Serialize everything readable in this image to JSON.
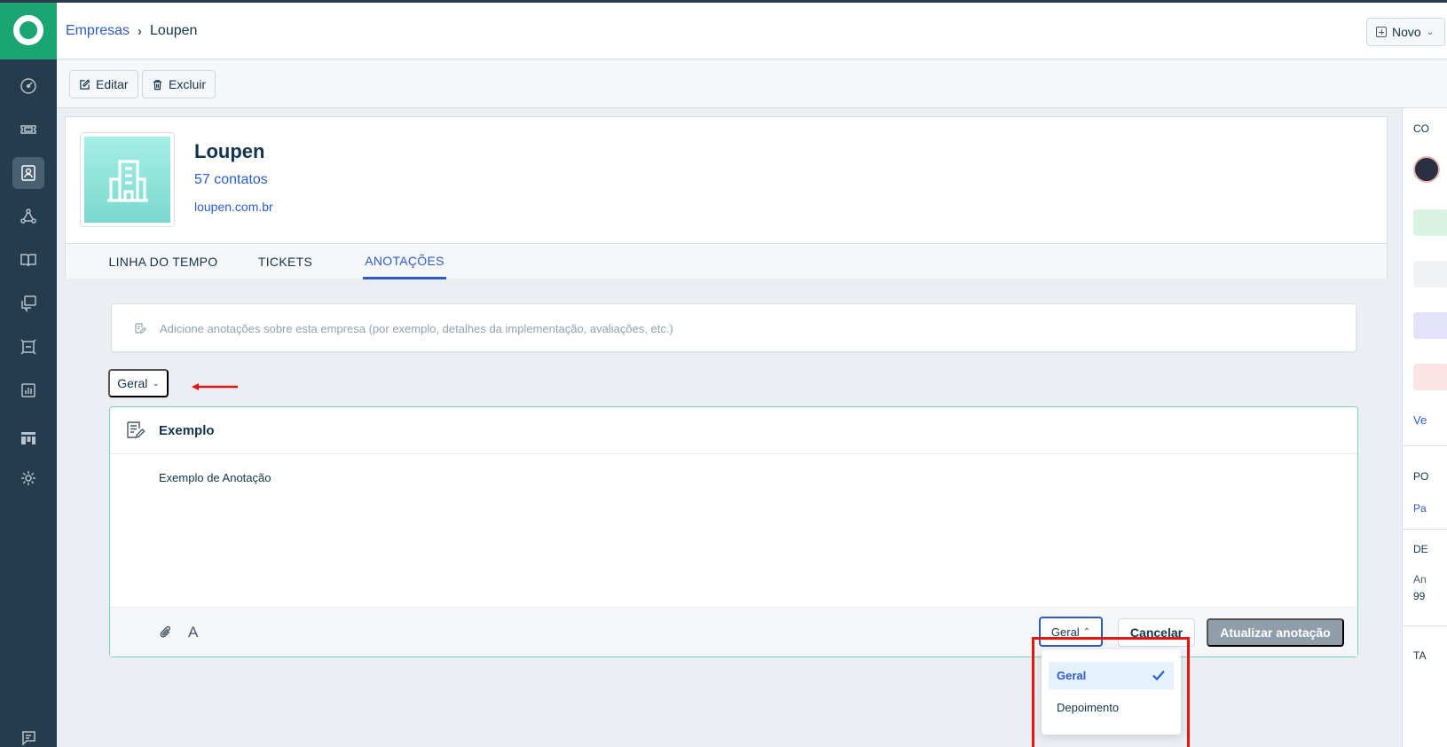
{
  "header": {
    "breadcrumb": {
      "parent": "Empresas",
      "current": "Loupen"
    },
    "new_button": "Novo"
  },
  "toolbar": {
    "edit_label": "Editar",
    "delete_label": "Excluir"
  },
  "company": {
    "name": "Loupen",
    "contacts": "57 contatos",
    "website": "loupen.com.br"
  },
  "tabs": [
    {
      "label": "LINHA DO TEMPO",
      "active": false
    },
    {
      "label": "TICKETS",
      "active": false
    },
    {
      "label": "ANOTAÇÕES",
      "active": true
    }
  ],
  "notes": {
    "add_placeholder": "Adicione anotações sobre esta empresa (por exemplo, detalhes da implementação, avaliações, etc.)",
    "filter_label": "Geral",
    "note": {
      "title": "Exemplo",
      "body": "Exemplo de Anotação",
      "type_label": "Geral",
      "cancel_label": "Cancelar",
      "update_label": "Atualizar anotação"
    },
    "type_options": [
      {
        "label": "Geral",
        "selected": true
      },
      {
        "label": "Depoimento",
        "selected": false
      }
    ]
  },
  "right_panel": {
    "t1": "CO",
    "link1": "Ve",
    "t2": "PO",
    "link2": "Pa",
    "t3": "DE",
    "t4": "An",
    "t5": "99",
    "t6": "TA"
  },
  "colors": {
    "sidebar": "#253c4f",
    "logo": "#1ba573",
    "accent": "#2c5cc5",
    "note_border": "#7fd1b5",
    "highlight": "#e8140f"
  }
}
